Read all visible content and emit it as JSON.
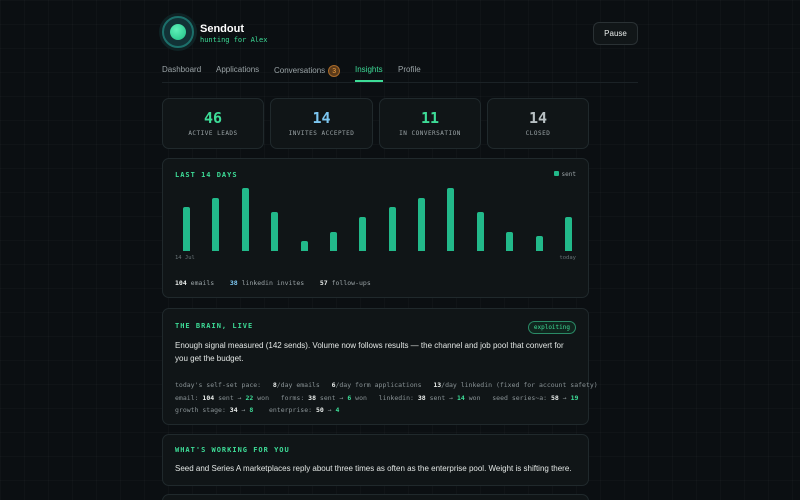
{
  "app": {
    "name": "Sendout",
    "tagline": "hunting for Alex",
    "pause_label": "Pause"
  },
  "tabs": [
    {
      "label": "Dashboard"
    },
    {
      "label": "Applications"
    },
    {
      "label": "Conversations",
      "badge": "3"
    },
    {
      "label": "Insights",
      "active": true
    },
    {
      "label": "Profile"
    }
  ],
  "stats": [
    {
      "value": "46",
      "label": "ACTIVE LEADS",
      "color": "#3ddc97"
    },
    {
      "value": "14",
      "label": "INVITES ACCEPTED",
      "color": "#7cc6f0"
    },
    {
      "value": "11",
      "label": "IN CONVERSATION",
      "color": "#3ddc97"
    },
    {
      "value": "14",
      "label": "CLOSED",
      "color": "#b8c0c3"
    }
  ],
  "chart_card": {
    "title": "LAST 14 DAYS",
    "legend": "sent",
    "x_start": "14 Jul",
    "x_end": "today",
    "summary": {
      "emails_count": "104",
      "emails_label": "emails",
      "linkedin_count": "38",
      "linkedin_label": "linkedin invites",
      "followups_count": "57",
      "followups_label": "follow-ups"
    }
  },
  "chart_data": {
    "type": "bar",
    "series": [
      {
        "name": "sent",
        "values": [
          9,
          11,
          13,
          8,
          2,
          4,
          7,
          9,
          11,
          13,
          8,
          4,
          3,
          7
        ]
      }
    ],
    "x_labels_shown": [
      "14 Jul",
      "today"
    ],
    "color": "#22b98a"
  },
  "brain": {
    "title": "THE BRAIN, LIVE",
    "badge": "exploiting",
    "text": "Enough signal measured (142 sends). Volume now follows results — the channel and job pool that convert for you get the budget.",
    "pace_label": "today's self-set pace:",
    "pace_emails": "8",
    "pace_emails_label": "/day emails",
    "pace_forms": "6",
    "pace_forms_label": "/day form applications",
    "pace_linkedin": "13",
    "pace_linkedin_label": "/day linkedin (fixed for account safety)",
    "email_label": "email:",
    "email_sent": "104",
    "email_won": "22",
    "forms_label": "forms:",
    "forms_sent": "38",
    "forms_won": "6",
    "linkedin_label": "linkedin:",
    "linkedin_sent": "38",
    "linkedin_won": "14",
    "seed_label": "seed series~a:",
    "seed_from": "58",
    "seed_to": "19",
    "growth_label": "growth stage:",
    "growth_from": "34",
    "growth_to": "8",
    "enterprise_label": "enterprise:",
    "enterprise_from": "50",
    "enterprise_to": "4",
    "sent_word": "sent",
    "won_word": "won",
    "arrow": "→"
  },
  "working": {
    "title": "WHAT'S WORKING FOR YOU",
    "text": "Seed and Series A marketplaces reply about three times as often as the enterprise pool. Weight is shifting there."
  }
}
